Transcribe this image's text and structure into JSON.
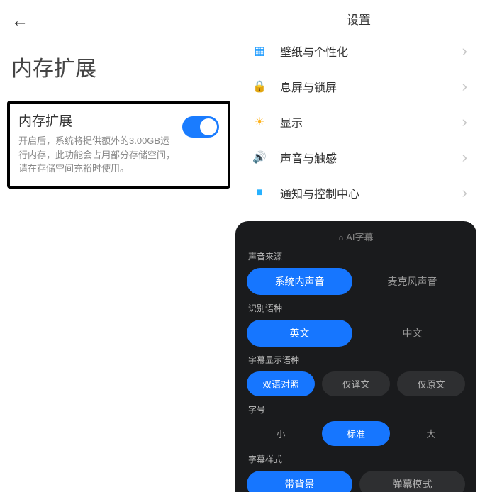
{
  "left": {
    "title": "内存扩展",
    "card": {
      "title": "内存扩展",
      "desc": "开启后，系统将提供额外的3.00GB运行内存，此功能会占用部分存储空间，请在存储空间充裕时使用。"
    }
  },
  "settings": {
    "header": "设置",
    "items": [
      {
        "label": "壁纸与个性化",
        "icon_glyph": "▦",
        "icon_class": "icon-wallpaper"
      },
      {
        "label": "息屏与锁屏",
        "icon_glyph": "🔒",
        "icon_class": "icon-lock"
      },
      {
        "label": "显示",
        "icon_glyph": "☀",
        "icon_class": "icon-display"
      },
      {
        "label": "声音与触感",
        "icon_glyph": "🔊",
        "icon_class": "icon-sound"
      },
      {
        "label": "通知与控制中心",
        "icon_glyph": "■",
        "icon_class": "icon-notify"
      }
    ]
  },
  "ai_panel": {
    "header": "AI字幕",
    "sections": {
      "audio_source": {
        "label": "声音来源",
        "options": [
          "系统内声音",
          "麦克风声音"
        ],
        "selected": 0
      },
      "recog_lang": {
        "label": "识别语种",
        "options": [
          "英文",
          "中文"
        ],
        "selected": 0
      },
      "display_lang": {
        "label": "字幕显示语种",
        "options": [
          "双语对照",
          "仅译文",
          "仅原文"
        ],
        "selected": 0
      },
      "font_size": {
        "label": "字号",
        "options": [
          "小",
          "标准",
          "大"
        ],
        "selected": 1
      },
      "style": {
        "label": "字幕样式",
        "options": [
          "带背景",
          "弹幕模式"
        ],
        "selected": 0
      }
    }
  }
}
